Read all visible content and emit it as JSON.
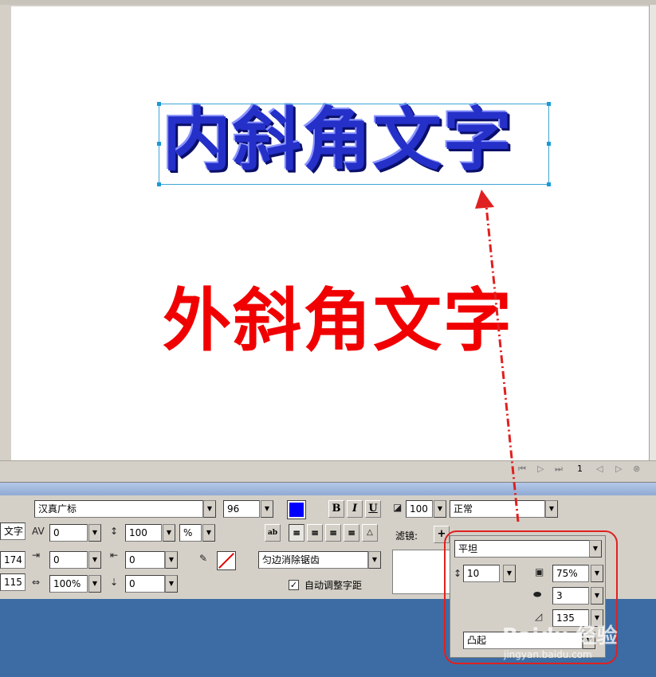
{
  "canvas": {
    "inner_bevel_text": "内斜角文字",
    "outer_bevel_text": "外斜角文字",
    "inner_text_color": "#2430c8",
    "outer_text_color": "#f00000"
  },
  "timeline": {
    "frame_number": "1"
  },
  "text_props": {
    "text_kind_label": "文字",
    "width_value": "174",
    "height_value": "115",
    "font_family": "汉真广标",
    "font_size": "96",
    "kerning": "0",
    "leading": "100",
    "leading_unit": "%",
    "indent": "0",
    "space_before": "0",
    "horizontal_scale": "100%",
    "space_after": "0",
    "fill_color": "#0000ff",
    "bold_label": "B",
    "italic_label": "I",
    "underline_label": "U",
    "antialias": "匀边消除锯齿",
    "auto_kern_label": "自动调整字距",
    "auto_kern_checked": "✓"
  },
  "effects": {
    "opacity": "100",
    "blend_mode": "正常",
    "filters_label": "滤镜:",
    "add_filter_label": "+"
  },
  "bevel_popup": {
    "edge_shape": "平坦",
    "width": "10",
    "contrast": "75%",
    "softness": "3",
    "angle": "135",
    "button_preset": "凸起"
  },
  "watermark": {
    "brand": "Baidu 经验",
    "url": "jingyan.baidu.com"
  }
}
